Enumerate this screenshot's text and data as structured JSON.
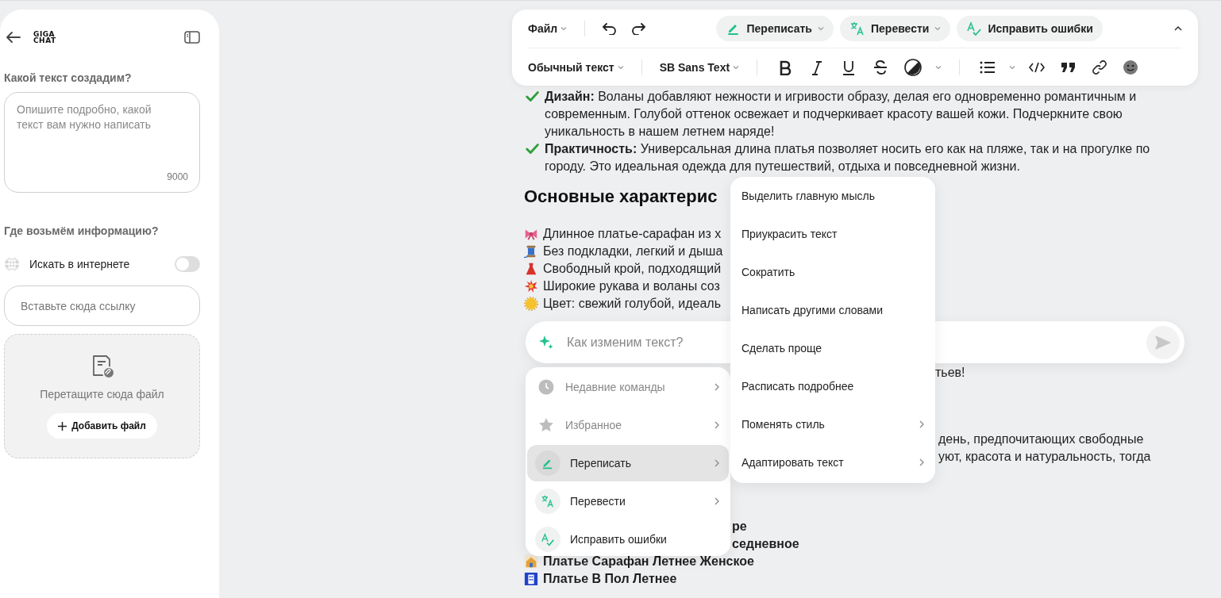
{
  "sidebar": {
    "logo_lines": [
      "GIGA",
      "CHAT"
    ],
    "prompt_heading": "Какой текст создадим?",
    "prompt_field": {
      "placeholder": "Опишите подробно, какой текст вам нужно написать",
      "counter": "9000"
    },
    "source_heading": "Где возьмём информацию?",
    "web_search": {
      "label": "Искать в интернете",
      "on": false
    },
    "link_field": {
      "placeholder": "Вставьте сюда ссылку"
    },
    "dropzone": {
      "hint": "Перетащите сюда файл",
      "button": "Добавить файл"
    }
  },
  "toolbar": {
    "file_menu": "Файл",
    "actions": [
      {
        "kind": "rewrite",
        "label": "Переписать",
        "dropdown": true
      },
      {
        "kind": "translate",
        "label": "Перевести",
        "dropdown": true
      },
      {
        "kind": "spellcheck",
        "label": "Исправить ошибки",
        "dropdown": false
      }
    ],
    "style_select": "Обычный текст",
    "font_select": "SB Sans Text"
  },
  "document": {
    "blocks": [
      {
        "kind": "checks",
        "items": [
          {
            "kind": "check",
            "text": "**Дизайн:** Воланы добавляют нежности и игривости образу, делая его одновременно романтичным и современным. Голубой оттенок освежает и подчеркивает красоту вашей кожи. Подчеркните свою уникальность в нашем летнем наряде!"
          },
          {
            "kind": "check",
            "text": "**Практичность:** Универсальная длина платья позволяет носить его как на пляже, так и на прогулке по городу. Это идеальная одежда для путешествий, отдыха и повседневной жизни."
          }
        ]
      },
      {
        "kind": "heading",
        "text": "Основные характерис"
      },
      {
        "kind": "list",
        "items": [
          {
            "kind": "bow",
            "text": "Длинное платье-сарафан из х"
          },
          {
            "kind": "spool",
            "text": "Без подкладки, легкий и дыша"
          },
          {
            "kind": "dress",
            "text": "Свободный крой, подходящий"
          },
          {
            "kind": "burst",
            "text": "Широкие рукава и воланы соз"
          },
          {
            "kind": "sun",
            "text": "Цвет: свежий голубой, идеаль"
          }
        ]
      },
      {
        "kind": "tail",
        "lines": [
          "тьев!"
        ]
      },
      {
        "kind": "tail",
        "lines": [
          "день, предпочитающих свободные",
          "уют, красота и натуральность, тогда"
        ]
      },
      {
        "kind": "tail-bold",
        "lines": [
          "ре",
          "седневное"
        ]
      },
      {
        "kind": "bold-list",
        "items": [
          {
            "kind": "house",
            "text": "Платье Сарафан Летнее Женское"
          },
          {
            "kind": "building",
            "text": "Платье В Пол Летнее"
          }
        ]
      }
    ]
  },
  "prompt": {
    "placeholder": "Как изменим текст?"
  },
  "command_menu": {
    "items": [
      {
        "kind": "recent",
        "label": "Недавние команды",
        "selected": false,
        "submenu": true
      },
      {
        "kind": "favorites",
        "label": "Избранное",
        "selected": false,
        "submenu": true
      },
      {
        "kind": "rewrite",
        "label": "Переписать",
        "selected": true,
        "submenu": true
      },
      {
        "kind": "translate",
        "label": "Перевести",
        "selected": false,
        "submenu": true
      },
      {
        "kind": "spellcheck",
        "label": "Исправить ошибки",
        "selected": false,
        "submenu": false
      }
    ]
  },
  "submenu": {
    "items": [
      {
        "label": "Выделить главную мысль",
        "submenu": false
      },
      {
        "label": "Приукрасить текст",
        "submenu": false
      },
      {
        "label": "Сократить",
        "submenu": false
      },
      {
        "label": "Написать другими словами",
        "submenu": false
      },
      {
        "label": "Сделать проще",
        "submenu": false
      },
      {
        "label": "Расписать подробнее",
        "submenu": false
      },
      {
        "label": "Поменять стиль",
        "submenu": true
      },
      {
        "label": "Адаптировать текст",
        "submenu": true
      }
    ]
  }
}
